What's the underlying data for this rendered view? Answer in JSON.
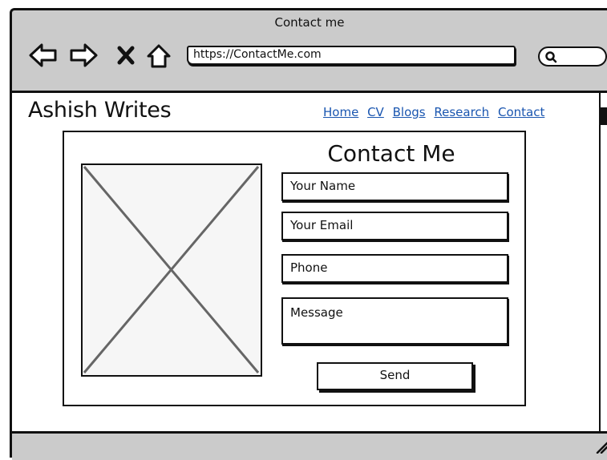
{
  "window": {
    "title": "Contact me"
  },
  "toolbar": {
    "back_icon": "back-arrow-icon",
    "forward_icon": "forward-arrow-icon",
    "stop_icon": "close-x-icon",
    "home_icon": "home-icon",
    "url": "https://ContactMe.com",
    "search_icon": "search-icon"
  },
  "site": {
    "brand": "Ashish Writes",
    "nav": [
      "Home",
      "CV",
      "Blogs",
      "Research",
      "Contact"
    ]
  },
  "contact": {
    "title": "Contact Me",
    "image_placeholder": "image-placeholder",
    "fields": {
      "name": "Your Name",
      "email": "Your Email",
      "phone": "Phone",
      "message": "Message"
    },
    "send_label": "Send"
  },
  "colors": {
    "chrome": "#cbcbcb",
    "link": "#1a56b0",
    "ink": "#111111"
  }
}
